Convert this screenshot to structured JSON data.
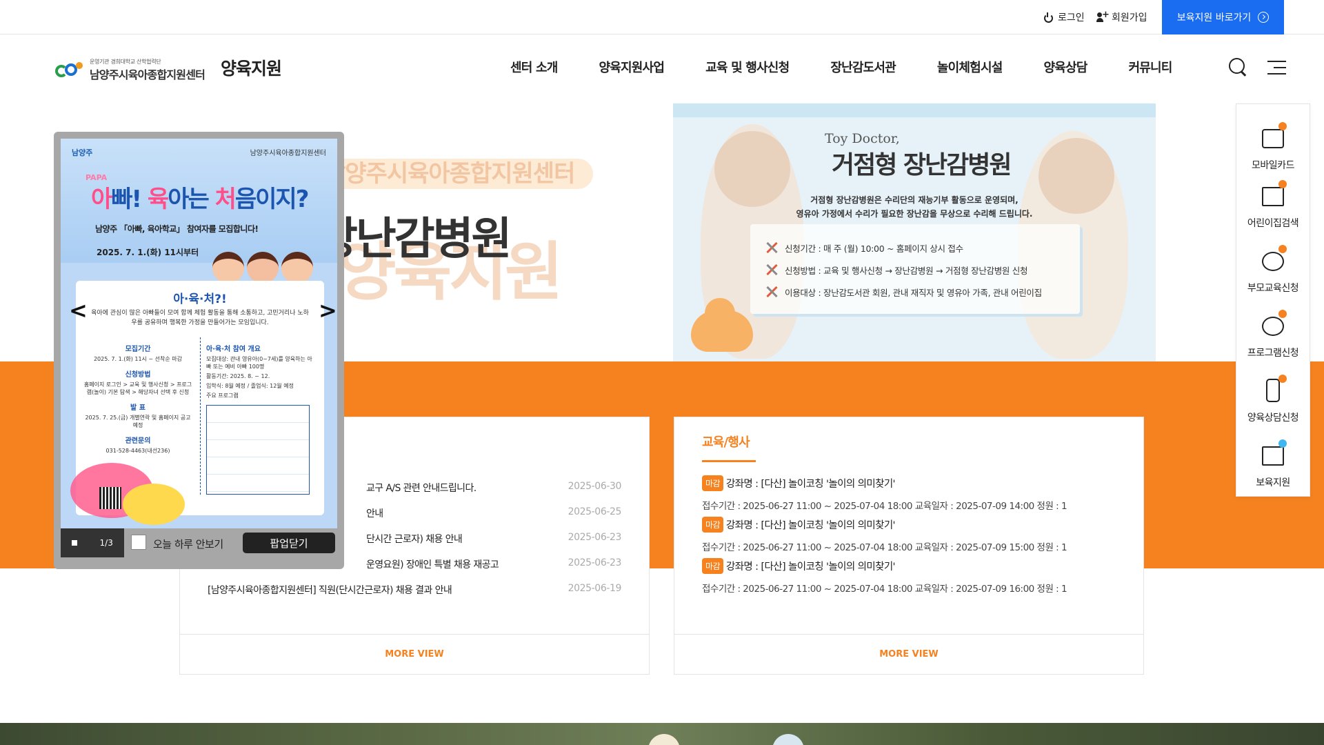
{
  "topbar": {
    "login_label": "로그인",
    "join_label": "회원가입",
    "quick_button_label": "보육지원 바로가기"
  },
  "header": {
    "logo_small": "운영기관 경희대학교 산학협력단",
    "logo_name": "남양주시육아종합지원센터",
    "site_title": "양육지원",
    "nav": [
      "센터 소개",
      "양육지원사업",
      "교육 및 행사신청",
      "장난감도서관",
      "놀이체험시설",
      "양육상담",
      "커뮤니티"
    ]
  },
  "visual": {
    "left_sub": "남양주시육아종합지원센터",
    "left_prefix": "병원",
    "left_main": "장난감병원",
    "left_bg": "양육지원"
  },
  "banner": {
    "toy_doctor": "Toy Doctor,",
    "title": "거점형 장난감병원",
    "desc_line1": "거점형 장난감병원은 수리단의 재능기부 활동으로 운영되며,",
    "desc_line2": "영유아 가정에서 수리가 필요한 장난감을 무상으로 수리해 드립니다.",
    "rows": [
      "신청기간 : 매 주 (월) 10:00 ~ 홈페이지 상시 접수",
      "신청방법 : 교육 및 행사신청 → 장난감병원 → 거점형 장난감병원 신청",
      "이용대상 : 장난감도서관 회원, 관내 재직자 및 영유아 가족, 관내 어린이집"
    ]
  },
  "quick_menu": {
    "items": [
      "모바일카드",
      "어린이집검색",
      "부모교육신청",
      "프로그램신청",
      "양육상담신청",
      "보육지원"
    ]
  },
  "notice_board": {
    "posts": [
      {
        "title": "교구 A/S 관련 안내드립니다.",
        "date": "2025-06-30"
      },
      {
        "title": "안내",
        "date": "2025-06-25"
      },
      {
        "title": "단시간 근로자) 채용 안내",
        "date": "2025-06-23"
      },
      {
        "title": "운영요원) 장애인 특별 채용 재공고",
        "date": "2025-06-23"
      },
      {
        "title": "[남양주시육아종합지원센터] 직원(단시간근로자) 채용 결과 안내",
        "date": "2025-06-19"
      }
    ],
    "more_label": "MORE VIEW"
  },
  "event_board": {
    "title": "교육/행사",
    "events": [
      {
        "badge": "마감",
        "title": "강좌명 : [다산] 놀이코칭 '놀이의 의미찾기'",
        "detail": "접수기간 : 2025-06-27 11:00 ~ 2025-07-04 18:00   교육일자 : 2025-07-09 14:00   정원 : 1"
      },
      {
        "badge": "마감",
        "title": "강좌명 : [다산] 놀이코칭 '놀이의 의미찾기'",
        "detail": "접수기간 : 2025-06-27 11:00 ~ 2025-07-04 18:00   교육일자 : 2025-07-09 15:00   정원 : 1"
      },
      {
        "badge": "마감",
        "title": "강좌명 : [다산] 놀이코칭 '놀이의 의미찾기'",
        "detail": "접수기간 : 2025-06-27 11:00 ~ 2025-07-04 18:00   교육일자 : 2025-07-09 16:00   정원 : 1"
      }
    ],
    "more_label": "MORE VIEW"
  },
  "popup": {
    "poster": {
      "logo_left": "남양주",
      "logo_right": "남양주시육아종합지원센터",
      "papa": "PAPA",
      "headline_a": "아",
      "headline_b": "빠! ",
      "headline_c": "육",
      "headline_d": "아는 ",
      "headline_e": "처",
      "headline_f": "음이지?",
      "sub": "남양주 「아빠, 육아학교」 참여자를 모집합니다!",
      "date": "2025. 7. 1.(화) 11시부터",
      "card_title": "아·육·처?!",
      "card_desc": "육아에 관심이 많은 아빠들이 모여 함께 체험 활동을 통해 소통하고, 고민거리나 노하우를 공유하며 행복한 가정을 만들어가는 모임입니다.",
      "left_blocks": [
        {
          "h": "모집기간",
          "t": "2025. 7. 1.(화) 11시 ~ 선착순 마감"
        },
        {
          "h": "신청방법",
          "t": "홈페이지 로그인 > 교육 및 행사신청 > 프로그램(놀이) 기본 탐색 > 해당자녀 선택 후 신청"
        },
        {
          "h": "발  표",
          "t": "2025. 7. 25.(금) 개별연락 및 홈페이지 공고 예정"
        },
        {
          "h": "관련문의",
          "t": "031-528-4463(내선236)"
        }
      ],
      "right_title": "아·육·처 참여 개요",
      "right_items": [
        "모집대상: 관내 영유아(0~7세)를 양육하는 아빠 또는 예비 아빠 100명",
        "활동기간: 2025. 8. ~ 12.",
        "입학식: 8월 예정 / 졸업식: 12월 예정",
        "주요 프로그램"
      ]
    },
    "prev_label": "<",
    "next_label": ">",
    "counter": "1/3",
    "today_label": "오늘 하루 안보기",
    "close_label": "팝업닫기"
  },
  "colors": {
    "accent_orange": "#f5821f",
    "button_blue": "#1a6cf0"
  }
}
